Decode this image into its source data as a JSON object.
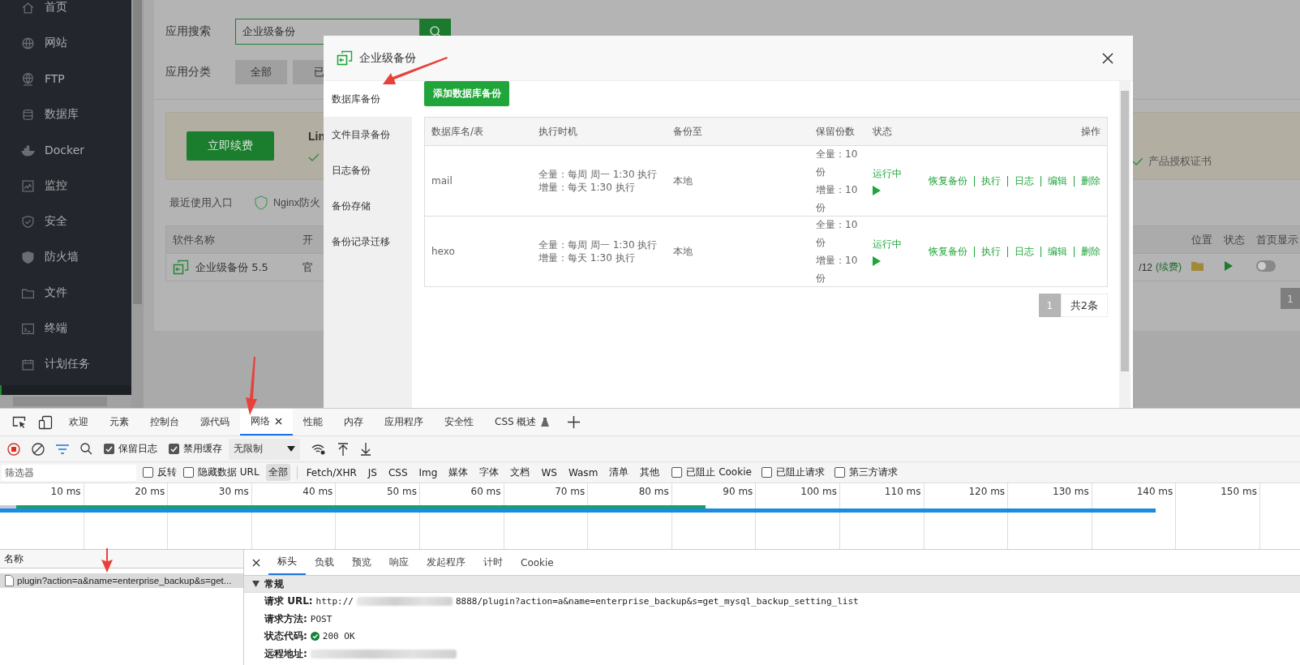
{
  "sidebar": {
    "items": [
      {
        "label": "首页"
      },
      {
        "label": "网站"
      },
      {
        "label": "FTP"
      },
      {
        "label": "数据库"
      },
      {
        "label": "Docker"
      },
      {
        "label": "监控"
      },
      {
        "label": "安全"
      },
      {
        "label": "防火墙"
      },
      {
        "label": "文件"
      },
      {
        "label": "终端"
      },
      {
        "label": "计划任务"
      }
    ]
  },
  "app_store": {
    "search_label": "应用搜索",
    "search_value": "企业级备份",
    "category_label": "应用分类",
    "categories": [
      {
        "label": "全部",
        "selected": false
      },
      {
        "label": "已",
        "selected": false
      }
    ],
    "renew_button": "立即续费",
    "product_title": "Lin",
    "license_item": "产品授权证书",
    "recent_label": "最近使用入口",
    "recent_items": [
      "Nginx防火"
    ],
    "table": {
      "columns_left": [
        "软件名称",
        "开"
      ],
      "columns_right": [
        "位置",
        "状态",
        "首页显示"
      ],
      "row": {
        "name": "企业级备份 5.5",
        "column_2": "官",
        "expiry": "/12",
        "renew": "(续费)",
        "running": true,
        "shown_on_home": false
      }
    },
    "page": "1"
  },
  "modal": {
    "title": "企业级备份",
    "nav": [
      {
        "label": "数据库备份",
        "selected": true
      },
      {
        "label": "文件目录备份",
        "selected": false
      },
      {
        "label": "日志备份",
        "selected": false
      },
      {
        "label": "备份存储",
        "selected": false
      },
      {
        "label": "备份记录迁移",
        "selected": false
      }
    ],
    "add_button": "添加数据库备份",
    "columns": [
      "数据库名/表",
      "执行时机",
      "备份至",
      "保留份数",
      "状态",
      "操作"
    ],
    "rows": [
      {
        "name": "mail",
        "schedule": [
          "全量：每周 周一 1:30 执行",
          "增量：每天 1:30 执行"
        ],
        "target": "本地",
        "retention": [
          "全量：10份",
          "增量：10份"
        ],
        "status": "运行中",
        "running": true,
        "actions": [
          "恢复备份",
          "执行",
          "日志",
          "编辑",
          "删除"
        ]
      },
      {
        "name": "hexo",
        "schedule": [
          "全量：每周 周一 1:30 执行",
          "增量：每天 1:30 执行"
        ],
        "target": "本地",
        "retention": [
          "全量：10份",
          "增量：10份"
        ],
        "status": "运行中",
        "running": true,
        "actions": [
          "恢复备份",
          "执行",
          "日志",
          "编辑",
          "删除"
        ]
      }
    ],
    "pagination": {
      "current": "1",
      "total": "共2条"
    }
  },
  "devtools": {
    "tabs": [
      {
        "label": "欢迎",
        "selected": false
      },
      {
        "label": "元素",
        "selected": false
      },
      {
        "label": "控制台",
        "selected": false
      },
      {
        "label": "源代码",
        "selected": false
      },
      {
        "label": "网络",
        "selected": true
      },
      {
        "label": "性能",
        "selected": false
      },
      {
        "label": "内存",
        "selected": false
      },
      {
        "label": "应用程序",
        "selected": false
      },
      {
        "label": "安全性",
        "selected": false
      },
      {
        "label": "CSS 概述",
        "selected": false,
        "experimental": true
      }
    ],
    "toolbar": {
      "recording": true,
      "checks": [
        {
          "label": "保留日志",
          "checked": true
        },
        {
          "label": "禁用缓存",
          "checked": true
        }
      ],
      "throttling": "无限制"
    },
    "filter": {
      "placeholder": "筛选器",
      "options": [
        {
          "label": "反转",
          "checked": false
        },
        {
          "label": "隐藏数据 URL",
          "checked": false
        }
      ],
      "types": [
        {
          "label": "全部",
          "selected": true
        },
        {
          "label": "Fetch/XHR",
          "selected": false
        },
        {
          "label": "JS",
          "selected": false
        },
        {
          "label": "CSS",
          "selected": false
        },
        {
          "label": "Img",
          "selected": false
        },
        {
          "label": "媒体",
          "selected": false
        },
        {
          "label": "字体",
          "selected": false
        },
        {
          "label": "文档",
          "selected": false
        },
        {
          "label": "WS",
          "selected": false
        },
        {
          "label": "Wasm",
          "selected": false
        },
        {
          "label": "清单",
          "selected": false
        },
        {
          "label": "其他",
          "selected": false
        }
      ],
      "extra": [
        {
          "label": "已阻止 Cookie",
          "checked": false
        },
        {
          "label": "已阻止请求",
          "checked": false
        },
        {
          "label": "第三方请求",
          "checked": false
        }
      ]
    },
    "timeline": {
      "ticks": [
        "10 ms",
        "20 ms",
        "30 ms",
        "40 ms",
        "50 ms",
        "60 ms",
        "70 ms",
        "80 ms",
        "90 ms",
        "100 ms",
        "110 ms",
        "120 ms",
        "130 ms",
        "140 ms",
        "150 ms"
      ]
    },
    "requests": {
      "column": "名称",
      "rows": [
        {
          "name": "plugin?action=a&name=enterprise_backup&s=get...",
          "selected": true
        }
      ]
    },
    "details": {
      "tabs": [
        {
          "label": "标头",
          "selected": true
        },
        {
          "label": "负载",
          "selected": false
        },
        {
          "label": "预览",
          "selected": false
        },
        {
          "label": "响应",
          "selected": false
        },
        {
          "label": "发起程序",
          "selected": false
        },
        {
          "label": "计时",
          "selected": false
        },
        {
          "label": "Cookie",
          "selected": false
        }
      ],
      "section": {
        "title": "常规",
        "expanded": true,
        "rows": [
          {
            "kind": "url",
            "label": "请求 URL:",
            "prefix": "http://",
            "value": "8888/plugin?action=a&name=enterprise_backup&s=get_mysql_backup_setting_list"
          },
          {
            "kind": "text",
            "label": "请求方法:",
            "value": "POST"
          },
          {
            "kind": "status",
            "label": "状态代码:",
            "value": "200 OK"
          },
          {
            "kind": "redacted",
            "label": "远程地址:"
          }
        ]
      }
    }
  }
}
